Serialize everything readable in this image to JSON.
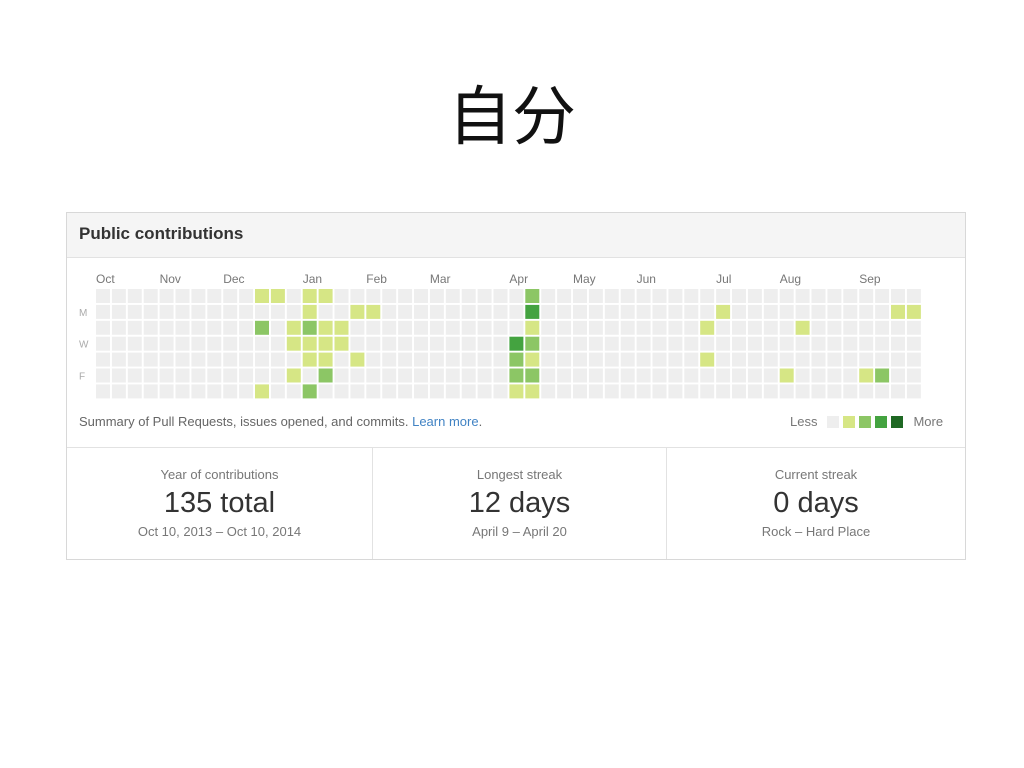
{
  "slide": {
    "title": "自分"
  },
  "panel": {
    "header": "Public contributions",
    "months": [
      "Oct",
      "Nov",
      "Dec",
      "Jan",
      "Feb",
      "Mar",
      "Apr",
      "May",
      "Jun",
      "Jul",
      "Aug",
      "Sep"
    ],
    "month_weeks": [
      0,
      4,
      8,
      13,
      17,
      21,
      26,
      30,
      34,
      39,
      43,
      48
    ],
    "day_labels": [
      {
        "row": 1,
        "text": "M"
      },
      {
        "row": 3,
        "text": "W"
      },
      {
        "row": 5,
        "text": "F"
      }
    ],
    "colors": [
      "#eeeeee",
      "#d6e685",
      "#8cc665",
      "#44a340",
      "#1e6823"
    ],
    "active_cells": [
      {
        "w": 10,
        "d": 0,
        "l": 1
      },
      {
        "w": 10,
        "d": 2,
        "l": 2
      },
      {
        "w": 10,
        "d": 6,
        "l": 1
      },
      {
        "w": 11,
        "d": 0,
        "l": 1
      },
      {
        "w": 12,
        "d": 2,
        "l": 1
      },
      {
        "w": 12,
        "d": 3,
        "l": 1
      },
      {
        "w": 12,
        "d": 5,
        "l": 1
      },
      {
        "w": 13,
        "d": 0,
        "l": 1
      },
      {
        "w": 13,
        "d": 1,
        "l": 1
      },
      {
        "w": 13,
        "d": 2,
        "l": 2
      },
      {
        "w": 13,
        "d": 3,
        "l": 1
      },
      {
        "w": 13,
        "d": 4,
        "l": 1
      },
      {
        "w": 13,
        "d": 6,
        "l": 2
      },
      {
        "w": 14,
        "d": 0,
        "l": 1
      },
      {
        "w": 14,
        "d": 2,
        "l": 1
      },
      {
        "w": 14,
        "d": 3,
        "l": 1
      },
      {
        "w": 14,
        "d": 4,
        "l": 1
      },
      {
        "w": 14,
        "d": 5,
        "l": 2
      },
      {
        "w": 15,
        "d": 2,
        "l": 1
      },
      {
        "w": 15,
        "d": 3,
        "l": 1
      },
      {
        "w": 16,
        "d": 1,
        "l": 1
      },
      {
        "w": 16,
        "d": 4,
        "l": 1
      },
      {
        "w": 17,
        "d": 1,
        "l": 1
      },
      {
        "w": 26,
        "d": 3,
        "l": 3
      },
      {
        "w": 26,
        "d": 4,
        "l": 2
      },
      {
        "w": 26,
        "d": 5,
        "l": 2
      },
      {
        "w": 26,
        "d": 6,
        "l": 1
      },
      {
        "w": 27,
        "d": 0,
        "l": 2
      },
      {
        "w": 27,
        "d": 1,
        "l": 3
      },
      {
        "w": 27,
        "d": 2,
        "l": 1
      },
      {
        "w": 27,
        "d": 3,
        "l": 2
      },
      {
        "w": 27,
        "d": 4,
        "l": 1
      },
      {
        "w": 27,
        "d": 5,
        "l": 2
      },
      {
        "w": 27,
        "d": 6,
        "l": 1
      },
      {
        "w": 38,
        "d": 2,
        "l": 1
      },
      {
        "w": 38,
        "d": 4,
        "l": 1
      },
      {
        "w": 39,
        "d": 1,
        "l": 1
      },
      {
        "w": 44,
        "d": 2,
        "l": 1
      },
      {
        "w": 43,
        "d": 5,
        "l": 1
      },
      {
        "w": 48,
        "d": 5,
        "l": 1
      },
      {
        "w": 49,
        "d": 5,
        "l": 2
      },
      {
        "w": 50,
        "d": 1,
        "l": 1
      },
      {
        "w": 51,
        "d": 1,
        "l": 1
      }
    ],
    "summary_text": "Summary of Pull Requests, issues opened, and commits. ",
    "learn_more": "Learn more",
    "summary_end": ".",
    "legend_less": "Less",
    "legend_more": "More"
  },
  "stats": [
    {
      "caption": "Year of contributions",
      "value": "135 total",
      "range": "Oct 10, 2013 – Oct 10, 2014"
    },
    {
      "caption": "Longest streak",
      "value": "12 days",
      "range": "April 9 – April 20"
    },
    {
      "caption": "Current streak",
      "value": "0 days",
      "range": "Rock – Hard Place"
    }
  ]
}
